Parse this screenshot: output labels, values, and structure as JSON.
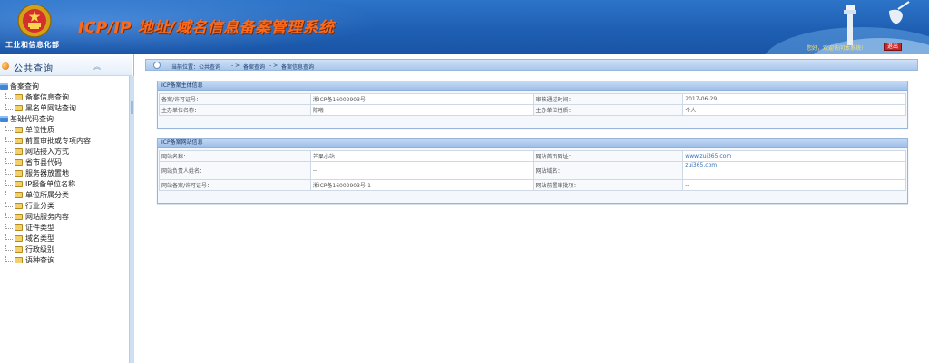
{
  "header": {
    "ministry": "工业和信息化部",
    "system_title": "ICP/IP 地址/域名信息备案管理系统",
    "welcome": "您好，欢迎访问本系统!",
    "logout": "退出"
  },
  "sidebar": {
    "title": "公共查询",
    "collapse_icon": "double-chevron-up",
    "groups": [
      {
        "label": "备案查询",
        "items": [
          "备案信息查询",
          "黑名单网站查询"
        ]
      },
      {
        "label": "基础代码查询",
        "items": [
          "单位性质",
          "前置审批或专项内容",
          "网站接入方式",
          "省市县代码",
          "服务器放置地",
          "IP报备单位名称",
          "单位所属分类",
          "行业分类",
          "网站服务内容",
          "证件类型",
          "域名类型",
          "行政级别",
          "语种查询"
        ]
      }
    ]
  },
  "breadcrumb": {
    "current_label": "当前位置：公共查询",
    "sep1": "- >",
    "level2": "备案查询",
    "sep2": "- >",
    "level3": "备案信息查询"
  },
  "subject_panel": {
    "title": "ICP备案主体信息",
    "rows": [
      [
        "备案/许可证号：",
        "湘ICP备16002903号",
        "审核通过时间：",
        "2017-06-29"
      ],
      [
        "主办单位名称：",
        "陈曦",
        "主办单位性质：",
        "个人"
      ]
    ]
  },
  "website_panel": {
    "title": "ICP备案网站信息",
    "rows": [
      [
        "网站名称：",
        "芒果小站",
        "网站首页网址：",
        "www.zui365.com"
      ],
      [
        "网站负责人姓名：",
        "--",
        "网站域名：",
        "zui365.com"
      ],
      [
        "网站备案/许可证号：",
        "湘ICP备16002903号-1",
        "网站前置审批项：",
        "--"
      ]
    ]
  },
  "colors": {
    "header_blue": "#1f5fb3",
    "title_orange": "#ff6a1a",
    "link_blue": "#2f6fb8"
  }
}
